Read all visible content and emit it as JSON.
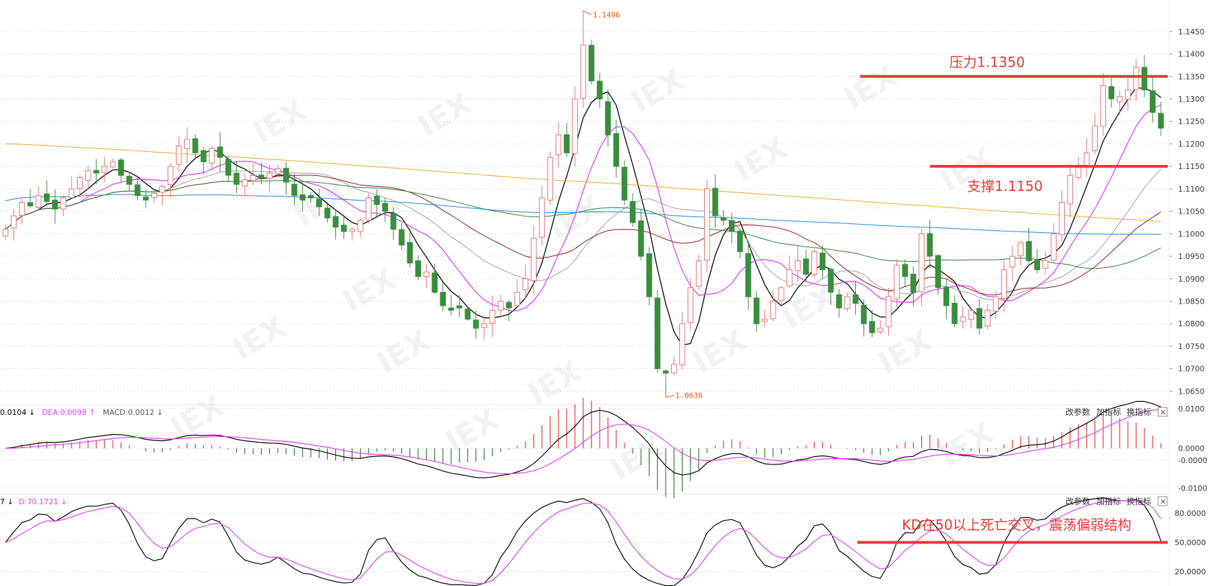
{
  "chart_data": [
    {
      "type": "candlestick",
      "panel": "price",
      "ylim": [
        1.062,
        1.152
      ],
      "yticks": [
        "1.1450",
        "1.1400",
        "1.1350",
        "1.1300",
        "1.1250",
        "1.1200",
        "1.1150",
        "1.1100",
        "1.1050",
        "1.1000",
        "1.0950",
        "1.0900",
        "1.0850",
        "1.0800",
        "1.0750",
        "1.0700",
        "1.0650"
      ],
      "grid": true,
      "candle_count": 106,
      "closes": [
        1.101,
        1.104,
        1.107,
        1.1062,
        1.1085,
        1.1072,
        1.1055,
        1.108,
        1.11,
        1.1125,
        1.114,
        1.1135,
        1.115,
        1.116,
        1.113,
        1.111,
        1.1085,
        1.1075,
        1.109,
        1.1105,
        1.115,
        1.1195,
        1.121,
        1.118,
        1.116,
        1.119,
        1.117,
        1.113,
        1.111,
        1.112,
        1.113,
        1.1125,
        1.1135,
        1.1145,
        1.1115,
        1.1085,
        1.1075,
        1.108,
        1.106,
        1.1035,
        1.1015,
        1.1005,
        1.101,
        1.103,
        1.108,
        1.1065,
        1.105,
        1.101,
        1.0975,
        1.0935,
        1.0905,
        1.0915,
        1.087,
        1.084,
        1.083,
        1.0835,
        1.081,
        1.079,
        1.08,
        1.083,
        1.085,
        1.0835,
        1.087,
        1.09,
        1.099,
        1.108,
        1.117,
        1.122,
        1.118,
        1.13,
        1.142,
        1.134,
        1.13,
        1.122,
        1.115,
        1.1075,
        1.1025,
        1.095,
        1.086,
        1.07,
        1.069,
        1.071,
        1.08,
        1.088,
        1.094,
        1.11,
        1.104,
        1.103,
        1.1005,
        1.096,
        1.086,
        1.08,
        1.081,
        1.085,
        1.088,
        1.092,
        1.094,
        1.091,
        1.096,
        1.092,
        1.087,
        1.0835,
        1.086,
        1.0845,
        1.08,
        1.078,
        1.079,
        1.086,
        1.093,
        1.0905,
        1.087,
        1.1,
        1.095,
        1.088,
        1.084,
        1.08,
        1.0815,
        1.083,
        1.079,
        1.083,
        1.086,
        1.092,
        1.095,
        1.098,
        1.094,
        1.092,
        1.094,
        1.1,
        1.107,
        1.113,
        1.115,
        1.118,
        1.124,
        1.133,
        1.13,
        1.1305,
        1.132,
        1.137,
        1.132,
        1.127,
        1.1235
      ],
      "high_label": "1.1496",
      "low_label": "1.0636",
      "high_value": 1.1496,
      "low_value": 1.0636,
      "ma_colors": [
        "#000000",
        "#e040fb",
        "#a0a0a0",
        "#8b1a1a",
        "#2e7d32",
        "#1e88e5",
        "#f5a623"
      ],
      "up_color": "#e57373",
      "down_color": "#388e3c",
      "annotations": [
        {
          "text": "压力1.1350",
          "level": 1.135
        },
        {
          "text": "支撑1.1150",
          "level": 1.115
        }
      ]
    },
    {
      "type": "macd",
      "panel": "macd",
      "legend": [
        {
          "text": "0.0104",
          "arrow": "↓",
          "color": "#000000"
        },
        {
          "text": "DEA:0.0098",
          "arrow": "↑",
          "color": "#e040fb"
        },
        {
          "text": "MACD:0.0012",
          "arrow": "↓",
          "color": "#555555"
        }
      ],
      "ylim": [
        -0.0115,
        0.011
      ],
      "yticks": [
        "0.0100",
        "0.0000",
        "-0.0000",
        "-0.0100"
      ]
    },
    {
      "type": "kd",
      "panel": "kd",
      "legend": [
        {
          "text": "7",
          "arrow": "↓",
          "color": "#000000"
        },
        {
          "text": "D:70.1721",
          "arrow": "↓",
          "color": "#e040fb"
        }
      ],
      "ylim": [
        5,
        100
      ],
      "yticks": [
        "80.0000",
        "50.0000",
        "20.0000"
      ],
      "annotation": {
        "text": "KD在50以上死亡交叉，震荡偏弱结构",
        "level": 50
      }
    }
  ],
  "panel_buttons": [
    "改参数",
    "加指标",
    "换指标"
  ],
  "close_symbol": "✕",
  "watermark": "IEX"
}
